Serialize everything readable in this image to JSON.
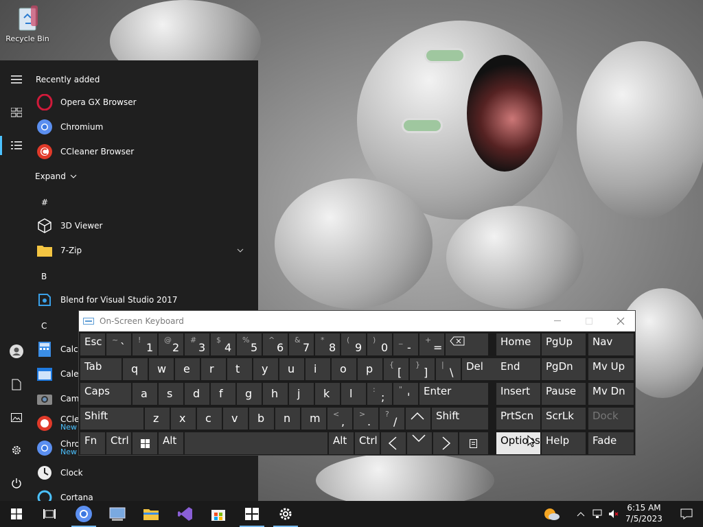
{
  "desktop": {
    "recycle_bin_label": "Recycle Bin"
  },
  "start_menu": {
    "recently_added_title": "Recently added",
    "recent_apps": [
      {
        "label": "Opera GX Browser",
        "icon": "opera-gx-icon"
      },
      {
        "label": "Chromium",
        "icon": "chromium-icon"
      },
      {
        "label": "CCleaner Browser",
        "icon": "ccleaner-browser-icon"
      }
    ],
    "expand_label": "Expand",
    "letters": {
      "hash": "#",
      "b": "B",
      "c": "C"
    },
    "apps": {
      "viewer3d": "3D Viewer",
      "zip": "7-Zip",
      "blend": "Blend for Visual Studio 2017",
      "calculator": "Calcu",
      "calendar": "Calen",
      "camera": "Came",
      "ccleaner": "CClea",
      "ccleaner_new": "New",
      "chromium": "Chron",
      "chromium_new": "New",
      "clock": "Clock",
      "cortana": "Cortana"
    }
  },
  "osk": {
    "title": "On-Screen Keyboard",
    "row1": [
      {
        "s": "",
        "m": "Esc"
      },
      {
        "s": "~",
        "m": "`"
      },
      {
        "s": "!",
        "m": "1"
      },
      {
        "s": "@",
        "m": "2"
      },
      {
        "s": "#",
        "m": "3"
      },
      {
        "s": "$",
        "m": "4"
      },
      {
        "s": "%",
        "m": "5"
      },
      {
        "s": "^",
        "m": "6"
      },
      {
        "s": "&",
        "m": "7"
      },
      {
        "s": "*",
        "m": "8"
      },
      {
        "s": "(",
        "m": "9"
      },
      {
        "s": ")",
        "m": "0"
      },
      {
        "s": "_",
        "m": "-"
      },
      {
        "s": "+",
        "m": "="
      }
    ],
    "row2": [
      "Tab",
      "q",
      "w",
      "e",
      "r",
      "t",
      "y",
      "u",
      "i",
      "o",
      "p"
    ],
    "row2_brackets": [
      {
        "s": "{",
        "m": "["
      },
      {
        "s": "}",
        "m": "]"
      },
      {
        "s": "|",
        "m": "\\"
      }
    ],
    "row2_del": "Del",
    "row3": [
      "Caps",
      "a",
      "s",
      "d",
      "f",
      "g",
      "h",
      "j",
      "k",
      "l"
    ],
    "row3_punct": [
      {
        "s": ":",
        "m": ";"
      },
      {
        "s": "\"",
        "m": "'"
      }
    ],
    "row3_enter": "Enter",
    "row4": [
      "Shift",
      "z",
      "x",
      "c",
      "v",
      "b",
      "n",
      "m"
    ],
    "row4_punct": [
      {
        "s": "<",
        "m": ","
      },
      {
        "s": ">",
        "m": "."
      },
      {
        "s": "?",
        "m": "/"
      }
    ],
    "row4_shift": "Shift",
    "row5": {
      "fn": "Fn",
      "ctrl": "Ctrl",
      "alt": "Alt",
      "alt2": "Alt",
      "ctrl2": "Ctrl"
    },
    "nav_keys": [
      [
        "Home",
        "PgUp",
        "Nav"
      ],
      [
        "End",
        "PgDn",
        "Mv Up"
      ],
      [
        "Insert",
        "Pause",
        "Mv Dn"
      ],
      [
        "PrtScn",
        "ScrLk",
        "Dock"
      ],
      [
        "Options",
        "Help",
        "Fade"
      ]
    ]
  },
  "taskbar": {
    "time": "6:15 AM",
    "date": "7/5/2023"
  },
  "colors": {
    "accent": "#4cc2ff",
    "taskbar": "#1a1a1a",
    "start_bg": "#1f1f1f"
  }
}
